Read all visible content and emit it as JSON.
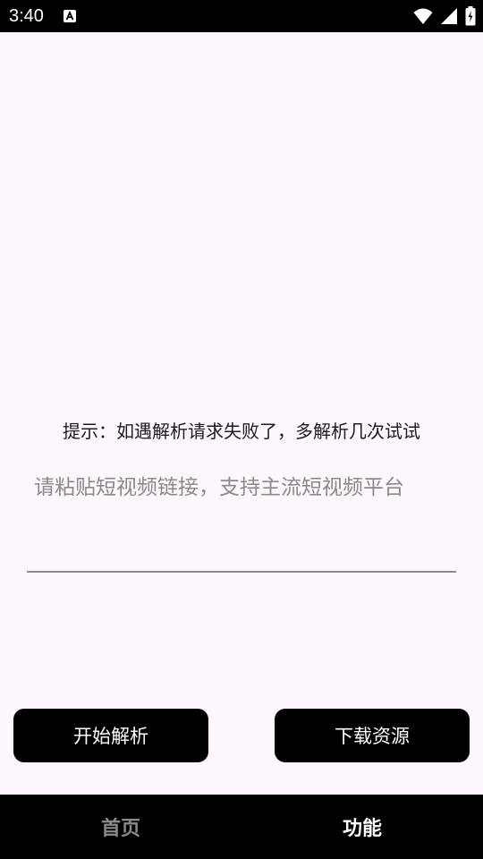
{
  "status_bar": {
    "time": "3:40",
    "notification_icon": "a-box-icon",
    "wifi_icon": "wifi-icon",
    "signal_icon": "signal-icon",
    "battery_icon": "battery-charging-icon"
  },
  "main": {
    "hint_text": "提示：如遇解析请求失败了，多解析几次试试",
    "url_input": {
      "value": "",
      "placeholder": "请粘贴短视频链接，支持主流短视频平台"
    },
    "parse_button_label": "开始解析",
    "download_button_label": "下载资源"
  },
  "bottom_nav": {
    "items": [
      {
        "label": "首页",
        "active": false
      },
      {
        "label": "功能",
        "active": true
      }
    ]
  },
  "colors": {
    "background": "#fdf7fd",
    "button": "#000000",
    "nav_active": "#ffffff",
    "nav_inactive": "#8a8a8a"
  }
}
